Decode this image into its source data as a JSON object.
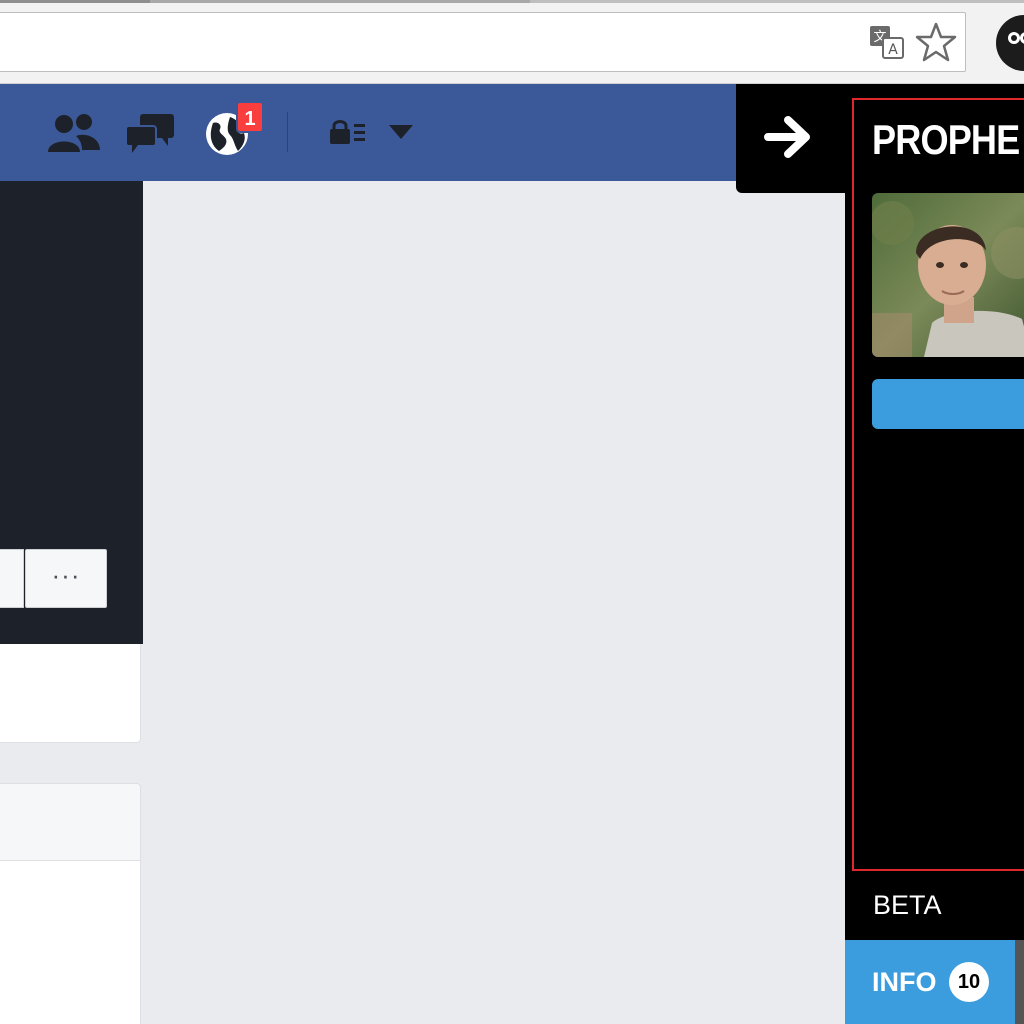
{
  "browser": {
    "translate_icon": "translate-icon",
    "bookmark_icon": "star-outline-icon",
    "extension_icon": "owl-extension-icon"
  },
  "facebook_bar": {
    "icons": [
      "friend-requests-icon",
      "messages-icon",
      "notifications-globe-icon",
      "privacy-shortcuts-icon",
      "account-dropdown-icon"
    ],
    "notification_count": "1",
    "color": "#3b5998"
  },
  "left_panel": {
    "more_button_label": "···"
  },
  "prophet": {
    "toggle_icon": "arrow-right-icon",
    "title": "PROPHE",
    "beta_label": "BETA",
    "tabs": [
      {
        "label": "INFO",
        "count": "10"
      }
    ],
    "accent_color": "#3b9ddd",
    "frame_color": "#e0282c"
  }
}
